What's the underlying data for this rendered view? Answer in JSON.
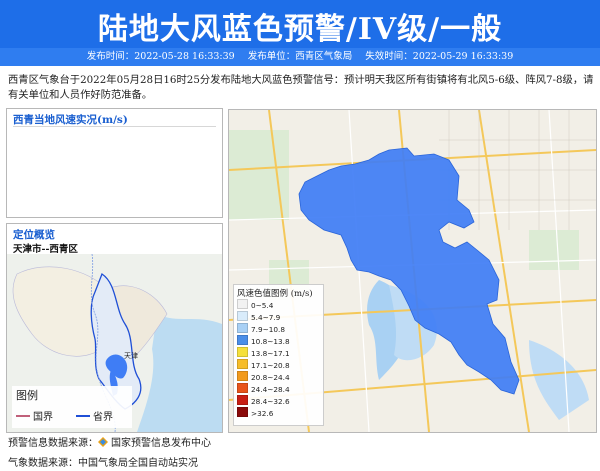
{
  "banner": {
    "title": "陆地大风蓝色预警/IV级/一般",
    "issue_time": "发布时间：2022-05-28 16:33:39",
    "issuer": "发布单位：西青区气象局",
    "expire_time": "失效时间：2022-05-29 16:33:39"
  },
  "description": "西青区气象台于2022年05月28日16时25分发布陆地大风蓝色预警信号：预计明天我区所有街镇将有北风5-6级、阵风7-8级，请有关单位和人员作好防范准备。",
  "wind_panel": {
    "title": "西青当地风速实况(m/s)"
  },
  "location_panel": {
    "title": "定位概览",
    "subtitle": "天津市--西青区",
    "map_label": "天津",
    "legend_title": "图例",
    "legend_items": [
      {
        "label": "国界",
        "color": "#c0607a"
      },
      {
        "label": "省界",
        "color": "#1f4fd6"
      }
    ]
  },
  "map": {
    "region_color": "#3f7df5",
    "legend_title": "风速色值图例 (m/s)",
    "legend_items": [
      {
        "label": "0~5.4",
        "color": "#f2f2f2"
      },
      {
        "label": "5.4~7.9",
        "color": "#d9ecfb"
      },
      {
        "label": "7.9~10.8",
        "color": "#a8d0f5"
      },
      {
        "label": "10.8~13.8",
        "color": "#4a8ee8"
      },
      {
        "label": "13.8~17.1",
        "color": "#f5e03a"
      },
      {
        "label": "17.1~20.8",
        "color": "#f6bd2a"
      },
      {
        "label": "20.8~24.4",
        "color": "#f29a1c"
      },
      {
        "label": "24.4~28.4",
        "color": "#e8541a"
      },
      {
        "label": "28.4~32.6",
        "color": "#c81e14"
      },
      {
        "label": ">32.6",
        "color": "#8a0a0a"
      }
    ]
  },
  "footer": {
    "warning_source_label": "预警信息数据来源：",
    "warning_source": "国家预警信息发布中心",
    "weather_source": "气象数据来源：中国气象局全国自动站实况"
  }
}
